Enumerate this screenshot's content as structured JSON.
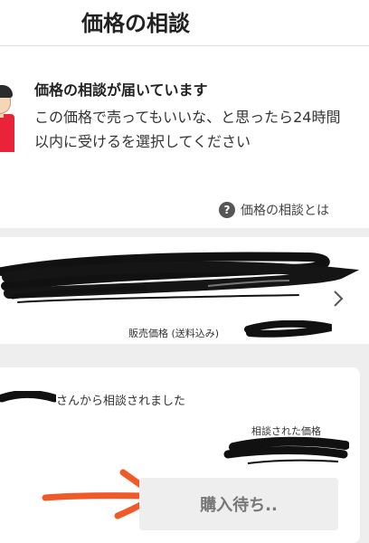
{
  "header": {
    "title": "価格の相談"
  },
  "notice": {
    "title": "価格の相談が届いています",
    "body": "この価格で売ってもいいな、と思ったら24時間以内に受けるを選択してください"
  },
  "help": {
    "icon": "question-circle-icon",
    "label": "価格の相談とは"
  },
  "product": {
    "name": "",
    "price_label": "販売価格 (送料込み)",
    "price": "",
    "chevron_icon": "chevron-right-icon"
  },
  "offer": {
    "requester_name": "",
    "requester_suffix": "さんから相談されました",
    "offered_price_label": "相談された価格",
    "offered_price": "",
    "button_label": "購入待ち.."
  },
  "colors": {
    "annotation_arrow": "#f05a28",
    "redaction_ink": "#111111",
    "separator": "#eeeeee",
    "disabled_button_bg": "#eeeeee",
    "disabled_button_text": "#777777"
  }
}
